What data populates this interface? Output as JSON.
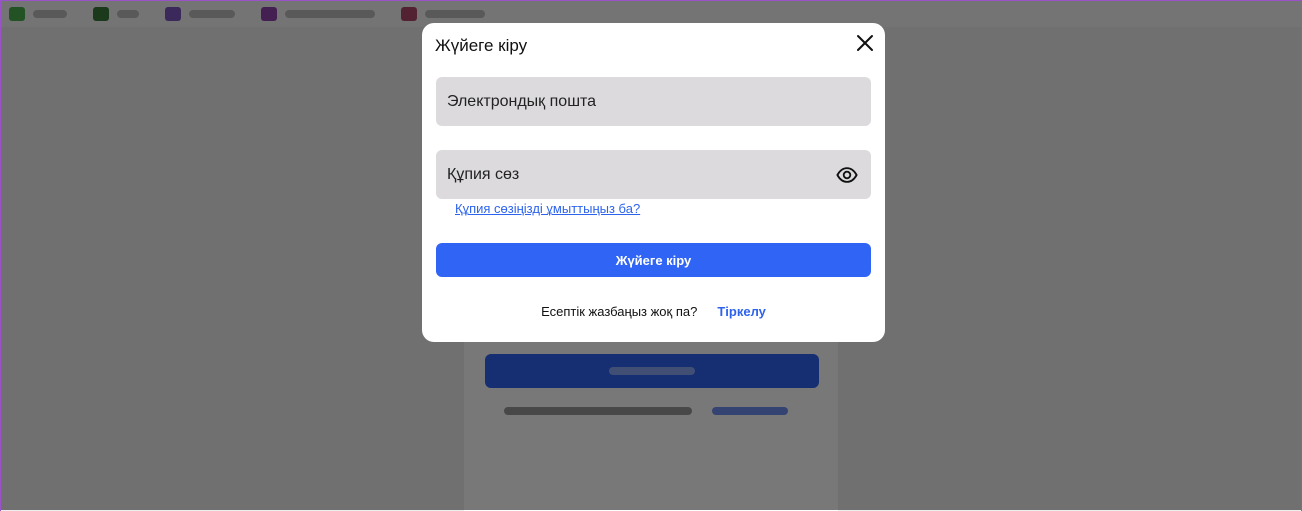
{
  "background": {
    "topbar_items": [
      {
        "icon": "green-app-icon",
        "color": "#4caf50"
      },
      {
        "icon": "monitor-icon",
        "color": "#3a7a3a"
      },
      {
        "icon": "purple-app-icon",
        "color": "#7e57c2"
      },
      {
        "icon": "purple-gamepad-icon",
        "color": "#8e44ad"
      },
      {
        "icon": "red-app-icon",
        "color": "#b04a6a"
      }
    ]
  },
  "modal": {
    "title": "Жүйеге кіру",
    "close_icon": "close-icon",
    "email": {
      "placeholder": "Электрондық пошта",
      "value": ""
    },
    "password": {
      "placeholder": "Құпия сөз",
      "value": "",
      "toggle_icon": "eye-icon"
    },
    "forgot_password": "Құпия сөзіңізді ұмыттыңыз ба?",
    "submit_label": "Жүйеге кіру",
    "no_account_text": "Есептік жазбаңыз жоқ па?",
    "register_label": "Тіркелу"
  },
  "colors": {
    "primary": "#2f64f5",
    "link": "#2d63ed",
    "field_bg": "#dcdadd",
    "overlay": "rgba(0,0,0,0.53)"
  }
}
